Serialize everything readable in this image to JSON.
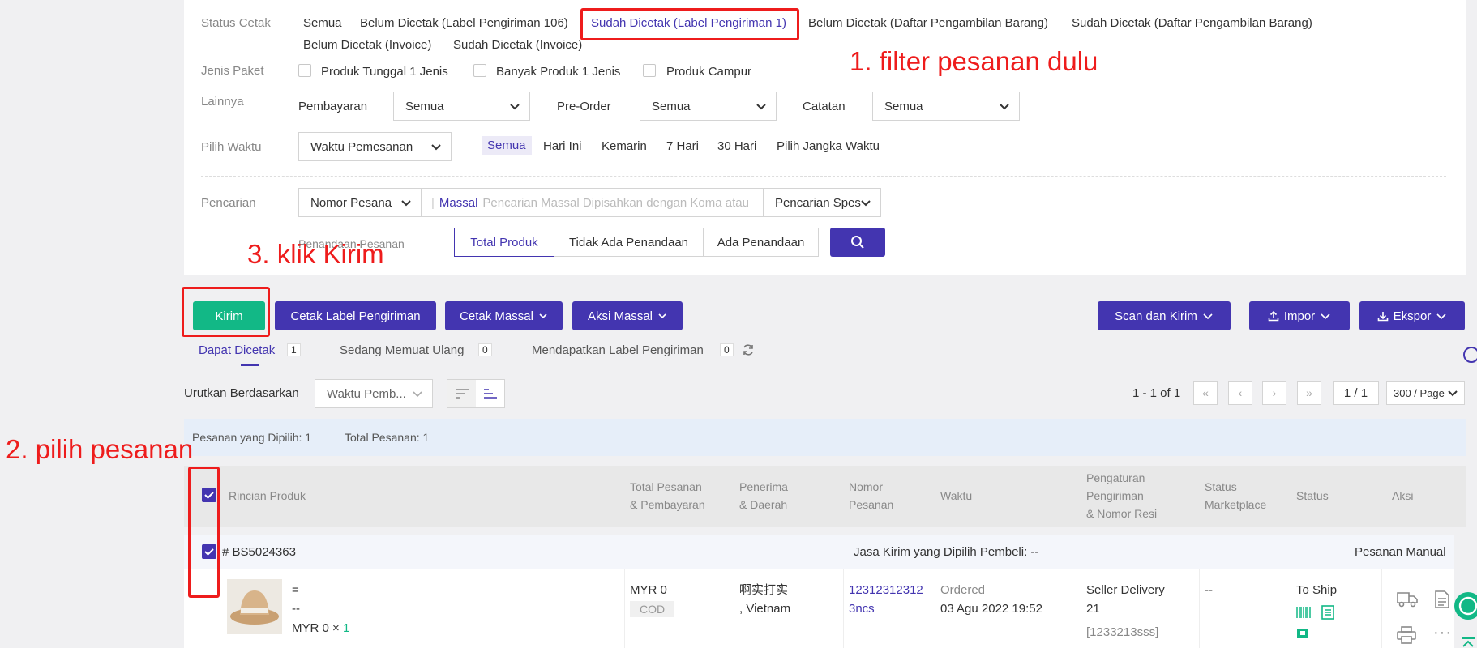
{
  "filters": {
    "status_label": "Status Cetak",
    "status_options": [
      "Semua",
      "Belum Dicetak (Label Pengiriman 106)",
      "Sudah Dicetak (Label Pengiriman 1)",
      "Belum Dicetak (Daftar Pengambilan Barang)",
      "Sudah Dicetak (Daftar Pengambilan Barang)",
      "Belum Dicetak (Invoice)",
      "Sudah Dicetak (Invoice)"
    ],
    "package_label": "Jenis Paket",
    "package_options": [
      "Produk Tunggal 1 Jenis",
      "Banyak Produk 1 Jenis",
      "Produk Campur"
    ],
    "other_label": "Lainnya",
    "payment_label": "Pembayaran",
    "payment_value": "Semua",
    "preorder_label": "Pre-Order",
    "preorder_value": "Semua",
    "note_label": "Catatan",
    "note_value": "Semua",
    "time_label": "Pilih Waktu",
    "time_select": "Waktu Pemesanan",
    "time_options": [
      "Semua",
      "Hari Ini",
      "Kemarin",
      "7 Hari",
      "30 Hari",
      "Pilih Jangka Waktu"
    ],
    "search_label": "Pencarian",
    "search_field": "Nomor Pesana",
    "mass_label": "Massal",
    "mass_placeholder": "Pencarian Massal Dipisahkan dengan Koma atau S",
    "special_search": "Pencarian Spes",
    "mark_label": "Penandaan Pesanan",
    "mark_options": [
      "Total Produk",
      "Tidak Ada Penandaan",
      "Ada Penandaan"
    ]
  },
  "actions": {
    "kirim": "Kirim",
    "print_label": "Cetak Label Pengiriman",
    "mass_print": "Cetak Massal",
    "mass_action": "Aksi Massal",
    "scan_ship": "Scan dan Kirim",
    "import": "Impor",
    "export": "Ekspor"
  },
  "tabs": [
    {
      "label": "Dapat Dicetak",
      "count": "1"
    },
    {
      "label": "Sedang Memuat Ulang",
      "count": "0"
    },
    {
      "label": "Mendapatkan Label Pengiriman",
      "count": "0"
    }
  ],
  "sort": {
    "label": "Urutkan Berdasarkan",
    "value": "Waktu Pemb..."
  },
  "pagination": {
    "range": "1 - 1 of 1",
    "page": "1 / 1",
    "per_page": "300 / Page"
  },
  "summary": {
    "selected": "Pesanan yang Dipilih: 1",
    "total": "Total Pesanan: 1"
  },
  "table": {
    "headers": {
      "product": "Rincian Produk",
      "total_1": "Total Pesanan",
      "total_2": "& Pembayaran",
      "recipient_1": "Penerima",
      "recipient_2": "& Daerah",
      "number_1": "Nomor",
      "number_2": "Pesanan",
      "time": "Waktu",
      "shipping_1": "Pengaturan",
      "shipping_2": "Pengiriman",
      "shipping_3": "& Nomor Resi",
      "marketplace_1": "Status",
      "marketplace_2": "Marketplace",
      "status": "Status",
      "action": "Aksi"
    },
    "order": {
      "id": "# BS5024363",
      "courier": "Jasa Kirim yang Dipilih Pembeli: --",
      "type": "Pesanan Manual",
      "product_line1": "=",
      "product_line2": "--",
      "product_price": "MYR 0",
      "product_times": "×",
      "product_qty": "1",
      "amount": "MYR 0",
      "payment": "COD",
      "recipient_name": "啊实打实",
      "recipient_region": ", Vietnam",
      "order_no_1": "12312312312",
      "order_no_2": "3ncs",
      "time_status": "Ordered",
      "time_value": "03 Agu 2022 19:52",
      "shipping_1": "Seller Delivery",
      "shipping_2": "21",
      "tracking": "[1233213sss]",
      "marketplace_status": "--",
      "status": "To Ship"
    }
  },
  "annotations": {
    "step1": "1. filter pesanan dulu",
    "step2": "2. pilih pesanan",
    "step3": "3. klik Kirim"
  },
  "colors": {
    "primary": "#4335b0",
    "green": "#12b886",
    "annotation": "#ee1c1c"
  }
}
